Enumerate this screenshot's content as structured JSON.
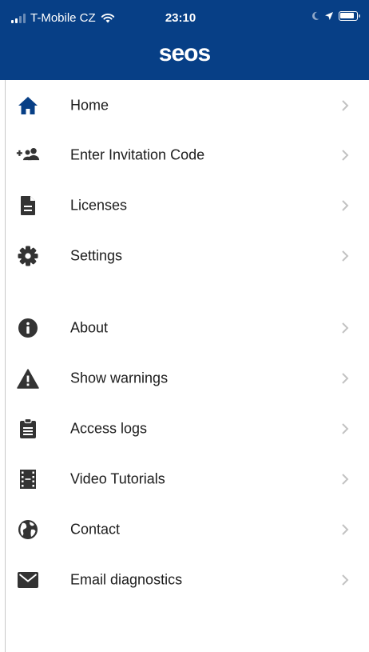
{
  "status_bar": {
    "carrier": "T-Mobile CZ",
    "time": "23:10"
  },
  "header": {
    "logo_text": "seos"
  },
  "colors": {
    "header_bg": "#073f86",
    "icon": "#333333",
    "chevron": "#c2c2c2"
  },
  "menu": {
    "items": [
      {
        "label": "Home",
        "icon": "home-icon"
      },
      {
        "label": "Enter Invitation Code",
        "icon": "add-users-icon"
      },
      {
        "label": "Licenses",
        "icon": "document-icon"
      },
      {
        "label": "Settings",
        "icon": "gear-icon"
      },
      {
        "label": "About",
        "icon": "info-icon"
      },
      {
        "label": "Show warnings",
        "icon": "warning-icon"
      },
      {
        "label": "Access logs",
        "icon": "clipboard-icon"
      },
      {
        "label": "Video Tutorials",
        "icon": "film-icon"
      },
      {
        "label": "Contact",
        "icon": "globe-icon"
      },
      {
        "label": "Email diagnostics",
        "icon": "envelope-icon"
      }
    ]
  }
}
